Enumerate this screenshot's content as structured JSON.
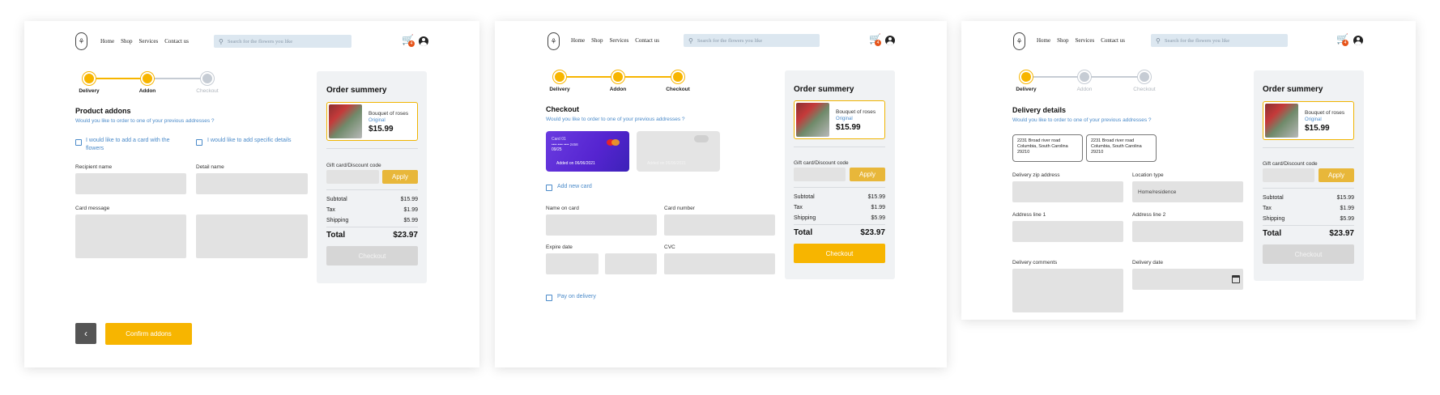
{
  "header": {
    "nav": [
      "Home",
      "Shop",
      "Services",
      "Contact us"
    ],
    "search_placeholder": "Search for the flowers you like",
    "cart_count": "4",
    "logo_glyph": "⚘"
  },
  "steps": [
    "Delivery",
    "Addon",
    "Checkout"
  ],
  "summary": {
    "title": "Order summery",
    "product_name": "Bouquet of roses",
    "product_variant": "Original",
    "product_price": "$15.99",
    "gift_label": "Gift card/Discount code",
    "apply_label": "Apply",
    "subtotal_label": "Subtotal",
    "subtotal": "$15.99",
    "tax_label": "Tax",
    "tax": "$1.99",
    "shipping_label": "Shipping",
    "shipping": "$5.99",
    "total_label": "Total",
    "total": "$23.97",
    "checkout_label": "Checkout"
  },
  "addon": {
    "title": "Product addons",
    "subtitle": "Would you like to order to one of your previous addresses ?",
    "opt1": "I would like to add a card with the flowers",
    "opt2": "I would like to add specific details",
    "recipient_label": "Recipient name",
    "detail_label": "Detail name",
    "card_message_label": "Card message",
    "back_glyph": "‹",
    "confirm_label": "Confirm addons"
  },
  "checkout": {
    "title": "Checkout",
    "subtitle": "Would you like to order to one of your previous addresses ?",
    "card1_name": "Card 01",
    "card1_number": "•••• •••• •••• 2458",
    "card1_exp": "09/25",
    "card1_added": "Added on 06/06/2021",
    "card2_added": "Added on 06/06/2021",
    "add_card_label": "Add new card",
    "name_label": "Name on card",
    "number_label": "Card number",
    "expire_label": "Expire date",
    "cvc_label": "CVC",
    "pay_delivery_label": "Pay on delivery"
  },
  "delivery": {
    "title": "Delivery details",
    "subtitle": "Would you like to order to one of your previous addresses ?",
    "addresses": [
      [
        "2231 Broad river road",
        "Columbia, South Carolina",
        "29210"
      ],
      [
        "2231 Broad river road",
        "Columbia, South Carolina",
        "29210"
      ]
    ],
    "zip_label": "Delivery zip address",
    "location_label": "Location type",
    "location_value": "Home/residence",
    "addr1_label": "Address line 1",
    "addr2_label": "Address line 2",
    "comments_label": "Delivery comments",
    "date_label": "Delivery date"
  },
  "colors": {
    "accent": "#f7b500",
    "link": "#4a8ac9",
    "card": "#5524d0"
  }
}
